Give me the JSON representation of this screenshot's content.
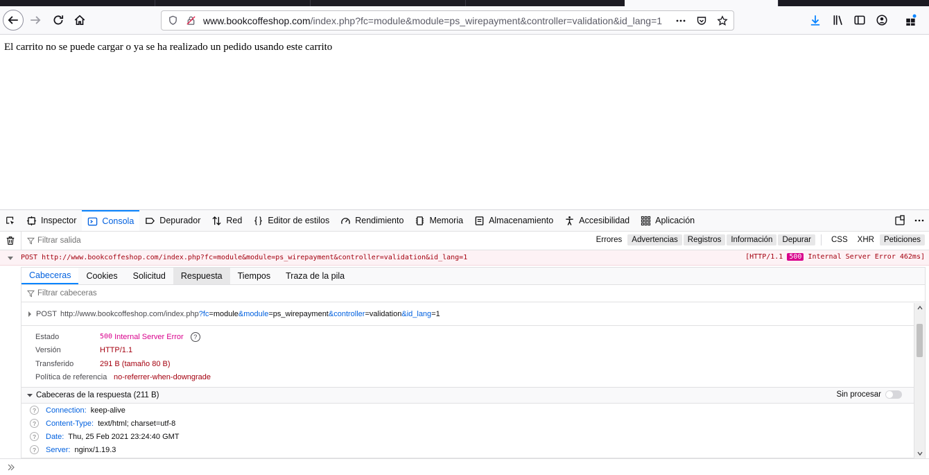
{
  "browser": {
    "url_host": "www.bookcoffeshop.com",
    "url_path": "/index.php?fc=module&module=ps_wirepayment&controller=validation&id_lang=1"
  },
  "page": {
    "message": "El carrito no se puede cargar o ya se ha realizado un pedido usando este carrito"
  },
  "devtools": {
    "tabs": [
      "Inspector",
      "Consola",
      "Depurador",
      "Red",
      "Editor de estilos",
      "Rendimiento",
      "Memoria",
      "Almacenamiento",
      "Accesibilidad",
      "Aplicación"
    ],
    "filter_placeholder": "Filtrar salida",
    "filters": [
      "Errores",
      "Advertencias",
      "Registros",
      "Información",
      "Depurar",
      "CSS",
      "XHR",
      "Peticiones"
    ],
    "log": {
      "method": "POST",
      "url": "http://www.bookcoffeshop.com/index.php?fc=module&module=ps_wirepayment&controller=validation&id_lang=1",
      "status_pre": "[HTTP/1.1",
      "status_code": "500",
      "status_post": "Internal Server Error 462ms]"
    },
    "panel": {
      "tabs": [
        "Cabeceras",
        "Cookies",
        "Solicitud",
        "Respuesta",
        "Tiempos",
        "Traza de la pila"
      ],
      "filter_placeholder": "Filtrar cabeceras",
      "request": {
        "method": "POST",
        "base": "http://www.bookcoffeshop.com/index.php",
        "q1k": "?fc",
        "q1v": "=module",
        "q2k": "&module",
        "q2v": "=ps_wirepayment",
        "q3k": "&controller",
        "q3v": "=validation",
        "q4k": "&id_lang",
        "q4v": "=1"
      },
      "estado_label": "Estado",
      "estado_code": "500",
      "estado_text": "Internal Server Error",
      "version_label": "Versión",
      "version_value": "HTTP/1.1",
      "transferido_label": "Transferido",
      "transferido_value": "291 B (tamaño 80 B)",
      "politica_label": "Política de referencia",
      "politica_value": "no-referrer-when-downgrade",
      "response_headers_title": "Cabeceras de la respuesta (211 B)",
      "raw_label": "Sin procesar",
      "headers": [
        {
          "name": "Connection:",
          "value": "keep-alive"
        },
        {
          "name": "Content-Type:",
          "value": "text/html; charset=utf-8"
        },
        {
          "name": "Date:",
          "value": "Thu, 25 Feb 2021 23:24:40 GMT"
        },
        {
          "name": "Server:",
          "value": "nginx/1.19.3"
        }
      ]
    }
  }
}
